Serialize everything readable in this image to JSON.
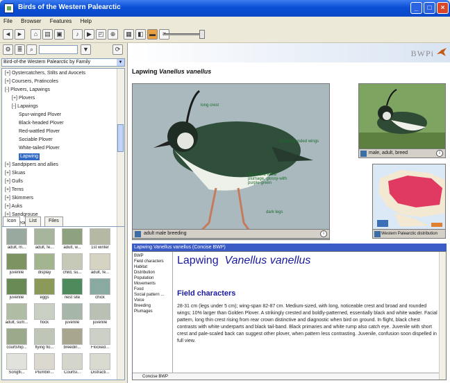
{
  "window": {
    "title": "Birds of the Western Palearctic",
    "controls": {
      "minimize": "_",
      "maximize": "□",
      "close": "×"
    }
  },
  "menu": [
    "File",
    "Browser",
    "Features",
    "Help"
  ],
  "toolbar": {
    "buttons": [
      "back-icon",
      "forward-icon",
      "home-icon",
      "print-icon",
      "copy-icon",
      "sound-icon",
      "video-icon",
      "map-icon",
      "zoom-icon",
      "layout-icon",
      "photo-icon",
      "notes-icon",
      "settings-icon"
    ]
  },
  "left": {
    "family_select": "Bird-of-the Western Palearctic by Family",
    "tree": [
      {
        "label": "Oystercatchers, Stilts and Avocets",
        "indent": 0,
        "expander": "+"
      },
      {
        "label": "Coursers, Pratincoles",
        "indent": 0,
        "expander": "+"
      },
      {
        "label": "Plovers, Lapwings",
        "indent": 0,
        "expander": "-"
      },
      {
        "label": "Plovers",
        "indent": 1,
        "expander": "+"
      },
      {
        "label": "Lapwings",
        "indent": 1,
        "expander": "-"
      },
      {
        "label": "Spur-winged Plover",
        "indent": 2,
        "expander": ""
      },
      {
        "label": "Black-headed Plover",
        "indent": 2,
        "expander": ""
      },
      {
        "label": "Red-wattled Plover",
        "indent": 2,
        "expander": ""
      },
      {
        "label": "Sociable Plover",
        "indent": 2,
        "expander": ""
      },
      {
        "label": "White-tailed Plover",
        "indent": 2,
        "expander": ""
      },
      {
        "label": "Lapwing",
        "indent": 2,
        "expander": "",
        "selected": true
      },
      {
        "label": "Sandpipers and allies",
        "indent": 0,
        "expander": "+"
      },
      {
        "label": "Skuas",
        "indent": 0,
        "expander": "+"
      },
      {
        "label": "Gulls",
        "indent": 0,
        "expander": "+"
      },
      {
        "label": "Terns",
        "indent": 0,
        "expander": "+"
      },
      {
        "label": "Skimmers",
        "indent": 0,
        "expander": "+"
      },
      {
        "label": "Auks",
        "indent": 0,
        "expander": "+"
      },
      {
        "label": "Sandgrouse",
        "indent": 0,
        "expander": "+"
      },
      {
        "label": "Pigeons",
        "indent": 0,
        "expander": "+"
      }
    ],
    "tabs": [
      "Icon",
      "List",
      "Files"
    ],
    "thumbnails": [
      {
        "caption": "adult, m...",
        "color": "#9aa9a0"
      },
      {
        "caption": "adult, fe...",
        "color": "#a7b59d"
      },
      {
        "caption": "adult, w...",
        "color": "#8fa27f"
      },
      {
        "caption": "1st winter",
        "color": "#b5b8a3"
      },
      {
        "caption": "juvenile",
        "color": "#7d9462"
      },
      {
        "caption": "display",
        "color": "#a3b58f"
      },
      {
        "caption": "child, su...",
        "color": "#c7c9b8"
      },
      {
        "caption": "adult, fe...",
        "color": "#d7d3c2"
      },
      {
        "caption": "juvenile",
        "color": "#6a8a55"
      },
      {
        "caption": "eggs",
        "color": "#8b9a58"
      },
      {
        "caption": "nest site",
        "color": "#4e8a5c"
      },
      {
        "caption": "chick",
        "color": "#8aa9a0"
      },
      {
        "caption": "adult, sum...",
        "color": "#b0bda5"
      },
      {
        "caption": "flock",
        "color": "#c9cfc3"
      },
      {
        "caption": "juvenile",
        "color": "#a6b7a9"
      },
      {
        "caption": "juvenile",
        "color": "#b8c1b3"
      },
      {
        "caption": "courtship...",
        "color": "#9caa8c"
      },
      {
        "caption": "flying flo...",
        "color": "#bfc6b8"
      },
      {
        "caption": "breedin...",
        "color": "#a8a68f"
      },
      {
        "caption": "Flocked...",
        "color": "#ccd0c6"
      },
      {
        "caption": "Songfli...",
        "color": "#e2e2dc"
      },
      {
        "caption": "Plumbin...",
        "color": "#dad8cf"
      },
      {
        "caption": "Courtsi...",
        "color": "#d4d6cc"
      },
      {
        "caption": "Distracti...",
        "color": "#d9dbd0"
      }
    ]
  },
  "right": {
    "brand": "BWPi",
    "heading_common": "Lapwing",
    "heading_latin": "Vanellus vanellus",
    "main_photo": {
      "caption": "adult male breeding",
      "labels": [
        "long crest",
        "black and white plumage, glossy-with purple-green",
        "dark legs",
        "broad rounded wings"
      ]
    },
    "side_photo": {
      "caption": "male, adult, breed"
    },
    "map": {
      "caption": "Western Palearctic distribution"
    },
    "text_header": "Lapwing  Vanellus vanellus (Concise BWP)",
    "toc": [
      "BWP",
      "Field characters",
      "Habitat",
      "Distribution",
      "Population",
      "Movements",
      "Food",
      "Social pattern ...",
      "Voice",
      "Breeding",
      "Plumages"
    ],
    "name_common": "Lapwing",
    "name_latin": "Vanellus vanellus",
    "section_title": "Field characters",
    "body": "28-31 cm (legs under 5 cm); wing-span 82-87 cm. Medium-sized, with long, noticeable crest and broad and rounded wings; 10% larger than Golden Plover. A strikingly crested and boldly-patterned, essentially black and white wader. Facial pattern, long thin crest rising from rear crown distinctive and diagnostic when bird on ground. In flight, black chest contrasts with white underparts and black tail-band. Black primaries and white rump also catch eye. Juvenile with short crest and pale-scaled back can suggest other plover, when pattern less contrasting. Juvenile, confusion soon dispelled in full view.",
    "footer": "Concise BWP"
  },
  "colors": {
    "titlebar": "#0a4fd6",
    "selection": "#316ac5",
    "text_header": "#3b5bc7",
    "heading_blue": "#1a1a9e",
    "map_range": "#e03a62"
  }
}
